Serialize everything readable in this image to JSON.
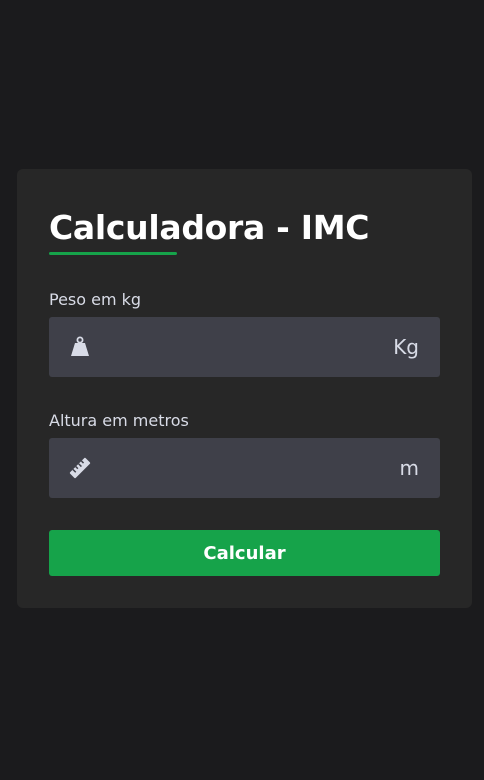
{
  "calculator": {
    "title": "Calculadora - IMC",
    "weight": {
      "label": "Peso em kg",
      "value": "",
      "placeholder": "",
      "unit": "Kg",
      "icon": "weight-icon"
    },
    "height": {
      "label": "Altura em metros",
      "value": "",
      "placeholder": "",
      "unit": "m",
      "icon": "ruler-icon"
    },
    "button_label": "Calcular"
  },
  "colors": {
    "background": "#1b1b1d",
    "card": "#272727",
    "field": "#3f4049",
    "accent": "#16a34a",
    "label": "#d8dbe6"
  }
}
